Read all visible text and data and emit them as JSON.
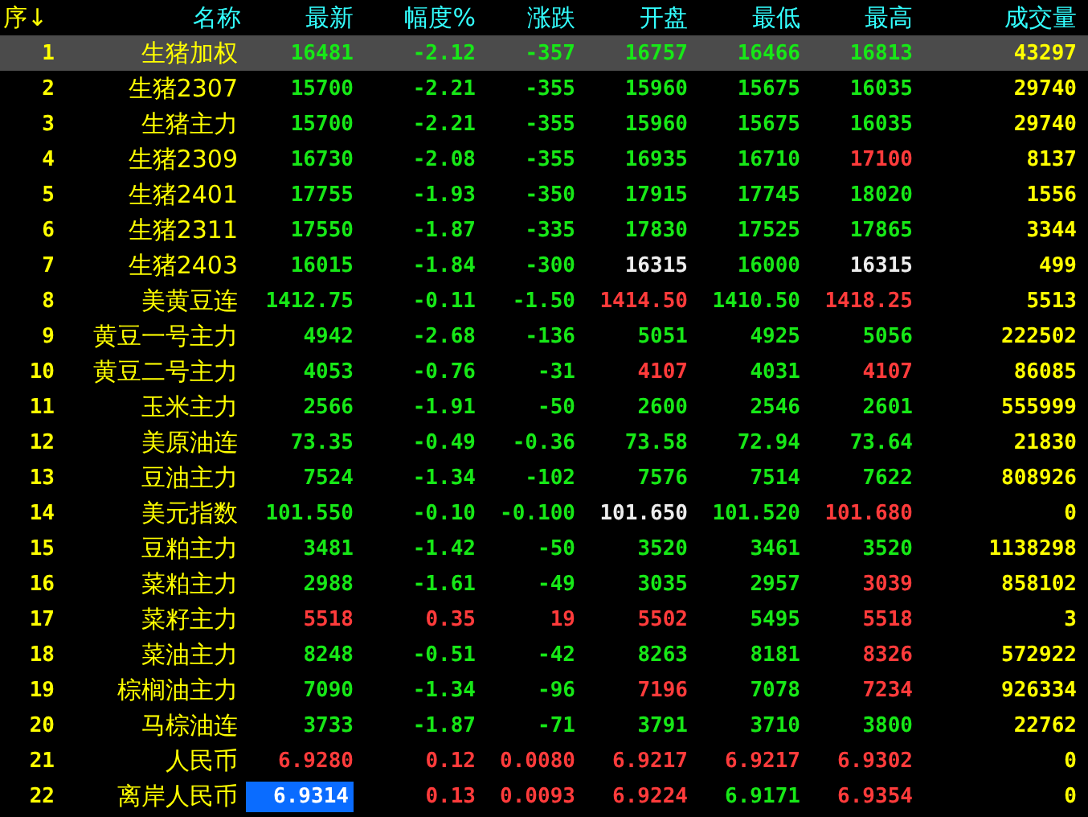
{
  "table": {
    "columns": [
      "序↓",
      "名称",
      "最新",
      "幅度%",
      "涨跌",
      "开盘",
      "最低",
      "最高",
      "成交量"
    ],
    "rows": [
      {
        "selected": true,
        "cells": [
          {
            "text": "1"
          },
          {
            "text": "生猪加权"
          },
          {
            "text": "16481",
            "color": "#17e817",
            "cursor": false
          },
          {
            "text": "-2.12",
            "color": "#17e817"
          },
          {
            "text": "-357",
            "color": "#17e817"
          },
          {
            "text": "16757",
            "color": "#17e817"
          },
          {
            "text": "16466",
            "color": "#17e817"
          },
          {
            "text": "16813",
            "color": "#17e817"
          },
          {
            "text": "43297"
          }
        ]
      },
      {
        "selected": false,
        "cells": [
          {
            "text": "2"
          },
          {
            "text": "生猪2307"
          },
          {
            "text": "15700",
            "color": "#17e817",
            "cursor": false
          },
          {
            "text": "-2.21",
            "color": "#17e817"
          },
          {
            "text": "-355",
            "color": "#17e817"
          },
          {
            "text": "15960",
            "color": "#17e817"
          },
          {
            "text": "15675",
            "color": "#17e817"
          },
          {
            "text": "16035",
            "color": "#17e817"
          },
          {
            "text": "29740"
          }
        ]
      },
      {
        "selected": false,
        "cells": [
          {
            "text": "3"
          },
          {
            "text": "生猪主力"
          },
          {
            "text": "15700",
            "color": "#17e817",
            "cursor": false
          },
          {
            "text": "-2.21",
            "color": "#17e817"
          },
          {
            "text": "-355",
            "color": "#17e817"
          },
          {
            "text": "15960",
            "color": "#17e817"
          },
          {
            "text": "15675",
            "color": "#17e817"
          },
          {
            "text": "16035",
            "color": "#17e817"
          },
          {
            "text": "29740"
          }
        ]
      },
      {
        "selected": false,
        "cells": [
          {
            "text": "4"
          },
          {
            "text": "生猪2309"
          },
          {
            "text": "16730",
            "color": "#17e817",
            "cursor": false
          },
          {
            "text": "-2.08",
            "color": "#17e817"
          },
          {
            "text": "-355",
            "color": "#17e817"
          },
          {
            "text": "16935",
            "color": "#17e817"
          },
          {
            "text": "16710",
            "color": "#17e817"
          },
          {
            "text": "17100",
            "color": "#ff3b3b"
          },
          {
            "text": "8137"
          }
        ]
      },
      {
        "selected": false,
        "cells": [
          {
            "text": "5"
          },
          {
            "text": "生猪2401"
          },
          {
            "text": "17755",
            "color": "#17e817",
            "cursor": false
          },
          {
            "text": "-1.93",
            "color": "#17e817"
          },
          {
            "text": "-350",
            "color": "#17e817"
          },
          {
            "text": "17915",
            "color": "#17e817"
          },
          {
            "text": "17745",
            "color": "#17e817"
          },
          {
            "text": "18020",
            "color": "#17e817"
          },
          {
            "text": "1556"
          }
        ]
      },
      {
        "selected": false,
        "cells": [
          {
            "text": "6"
          },
          {
            "text": "生猪2311"
          },
          {
            "text": "17550",
            "color": "#17e817",
            "cursor": false
          },
          {
            "text": "-1.87",
            "color": "#17e817"
          },
          {
            "text": "-335",
            "color": "#17e817"
          },
          {
            "text": "17830",
            "color": "#17e817"
          },
          {
            "text": "17525",
            "color": "#17e817"
          },
          {
            "text": "17865",
            "color": "#17e817"
          },
          {
            "text": "3344"
          }
        ]
      },
      {
        "selected": false,
        "cells": [
          {
            "text": "7"
          },
          {
            "text": "生猪2403"
          },
          {
            "text": "16015",
            "color": "#17e817",
            "cursor": false
          },
          {
            "text": "-1.84",
            "color": "#17e817"
          },
          {
            "text": "-300",
            "color": "#17e817"
          },
          {
            "text": "16315",
            "color": "#eeeeee"
          },
          {
            "text": "16000",
            "color": "#17e817"
          },
          {
            "text": "16315",
            "color": "#eeeeee"
          },
          {
            "text": "499"
          }
        ]
      },
      {
        "selected": false,
        "cells": [
          {
            "text": "8"
          },
          {
            "text": "美黄豆连"
          },
          {
            "text": "1412.75",
            "color": "#17e817",
            "cursor": false
          },
          {
            "text": "-0.11",
            "color": "#17e817"
          },
          {
            "text": "-1.50",
            "color": "#17e817"
          },
          {
            "text": "1414.50",
            "color": "#ff3b3b"
          },
          {
            "text": "1410.50",
            "color": "#17e817"
          },
          {
            "text": "1418.25",
            "color": "#ff3b3b"
          },
          {
            "text": "5513"
          }
        ]
      },
      {
        "selected": false,
        "cells": [
          {
            "text": "9"
          },
          {
            "text": "黄豆一号主力"
          },
          {
            "text": "4942",
            "color": "#17e817",
            "cursor": false
          },
          {
            "text": "-2.68",
            "color": "#17e817"
          },
          {
            "text": "-136",
            "color": "#17e817"
          },
          {
            "text": "5051",
            "color": "#17e817"
          },
          {
            "text": "4925",
            "color": "#17e817"
          },
          {
            "text": "5056",
            "color": "#17e817"
          },
          {
            "text": "222502"
          }
        ]
      },
      {
        "selected": false,
        "cells": [
          {
            "text": "10"
          },
          {
            "text": "黄豆二号主力"
          },
          {
            "text": "4053",
            "color": "#17e817",
            "cursor": false
          },
          {
            "text": "-0.76",
            "color": "#17e817"
          },
          {
            "text": "-31",
            "color": "#17e817"
          },
          {
            "text": "4107",
            "color": "#ff3b3b"
          },
          {
            "text": "4031",
            "color": "#17e817"
          },
          {
            "text": "4107",
            "color": "#ff3b3b"
          },
          {
            "text": "86085"
          }
        ]
      },
      {
        "selected": false,
        "cells": [
          {
            "text": "11"
          },
          {
            "text": "玉米主力"
          },
          {
            "text": "2566",
            "color": "#17e817",
            "cursor": false
          },
          {
            "text": "-1.91",
            "color": "#17e817"
          },
          {
            "text": "-50",
            "color": "#17e817"
          },
          {
            "text": "2600",
            "color": "#17e817"
          },
          {
            "text": "2546",
            "color": "#17e817"
          },
          {
            "text": "2601",
            "color": "#17e817"
          },
          {
            "text": "555999"
          }
        ]
      },
      {
        "selected": false,
        "cells": [
          {
            "text": "12"
          },
          {
            "text": "美原油连"
          },
          {
            "text": "73.35",
            "color": "#17e817",
            "cursor": false
          },
          {
            "text": "-0.49",
            "color": "#17e817"
          },
          {
            "text": "-0.36",
            "color": "#17e817"
          },
          {
            "text": "73.58",
            "color": "#17e817"
          },
          {
            "text": "72.94",
            "color": "#17e817"
          },
          {
            "text": "73.64",
            "color": "#17e817"
          },
          {
            "text": "21830"
          }
        ]
      },
      {
        "selected": false,
        "cells": [
          {
            "text": "13"
          },
          {
            "text": "豆油主力"
          },
          {
            "text": "7524",
            "color": "#17e817",
            "cursor": false
          },
          {
            "text": "-1.34",
            "color": "#17e817"
          },
          {
            "text": "-102",
            "color": "#17e817"
          },
          {
            "text": "7576",
            "color": "#17e817"
          },
          {
            "text": "7514",
            "color": "#17e817"
          },
          {
            "text": "7622",
            "color": "#17e817"
          },
          {
            "text": "808926"
          }
        ]
      },
      {
        "selected": false,
        "cells": [
          {
            "text": "14"
          },
          {
            "text": "美元指数"
          },
          {
            "text": "101.550",
            "color": "#17e817",
            "cursor": false
          },
          {
            "text": "-0.10",
            "color": "#17e817"
          },
          {
            "text": "-0.100",
            "color": "#17e817"
          },
          {
            "text": "101.650",
            "color": "#eeeeee"
          },
          {
            "text": "101.520",
            "color": "#17e817"
          },
          {
            "text": "101.680",
            "color": "#ff3b3b"
          },
          {
            "text": "0"
          }
        ]
      },
      {
        "selected": false,
        "cells": [
          {
            "text": "15"
          },
          {
            "text": "豆粕主力"
          },
          {
            "text": "3481",
            "color": "#17e817",
            "cursor": false
          },
          {
            "text": "-1.42",
            "color": "#17e817"
          },
          {
            "text": "-50",
            "color": "#17e817"
          },
          {
            "text": "3520",
            "color": "#17e817"
          },
          {
            "text": "3461",
            "color": "#17e817"
          },
          {
            "text": "3520",
            "color": "#17e817"
          },
          {
            "text": "1138298"
          }
        ]
      },
      {
        "selected": false,
        "cells": [
          {
            "text": "16"
          },
          {
            "text": "菜粕主力"
          },
          {
            "text": "2988",
            "color": "#17e817",
            "cursor": false
          },
          {
            "text": "-1.61",
            "color": "#17e817"
          },
          {
            "text": "-49",
            "color": "#17e817"
          },
          {
            "text": "3035",
            "color": "#17e817"
          },
          {
            "text": "2957",
            "color": "#17e817"
          },
          {
            "text": "3039",
            "color": "#ff3b3b"
          },
          {
            "text": "858102"
          }
        ]
      },
      {
        "selected": false,
        "cells": [
          {
            "text": "17"
          },
          {
            "text": "菜籽主力"
          },
          {
            "text": "5518",
            "color": "#ff3b3b",
            "cursor": false
          },
          {
            "text": "0.35",
            "color": "#ff3b3b"
          },
          {
            "text": "19",
            "color": "#ff3b3b"
          },
          {
            "text": "5502",
            "color": "#ff3b3b"
          },
          {
            "text": "5495",
            "color": "#17e817"
          },
          {
            "text": "5518",
            "color": "#ff3b3b"
          },
          {
            "text": "3"
          }
        ]
      },
      {
        "selected": false,
        "cells": [
          {
            "text": "18"
          },
          {
            "text": "菜油主力"
          },
          {
            "text": "8248",
            "color": "#17e817",
            "cursor": false
          },
          {
            "text": "-0.51",
            "color": "#17e817"
          },
          {
            "text": "-42",
            "color": "#17e817"
          },
          {
            "text": "8263",
            "color": "#17e817"
          },
          {
            "text": "8181",
            "color": "#17e817"
          },
          {
            "text": "8326",
            "color": "#ff3b3b"
          },
          {
            "text": "572922"
          }
        ]
      },
      {
        "selected": false,
        "cells": [
          {
            "text": "19"
          },
          {
            "text": "棕榈油主力"
          },
          {
            "text": "7090",
            "color": "#17e817",
            "cursor": false
          },
          {
            "text": "-1.34",
            "color": "#17e817"
          },
          {
            "text": "-96",
            "color": "#17e817"
          },
          {
            "text": "7196",
            "color": "#ff3b3b"
          },
          {
            "text": "7078",
            "color": "#17e817"
          },
          {
            "text": "7234",
            "color": "#ff3b3b"
          },
          {
            "text": "926334"
          }
        ]
      },
      {
        "selected": false,
        "cells": [
          {
            "text": "20"
          },
          {
            "text": "马棕油连"
          },
          {
            "text": "3733",
            "color": "#17e817",
            "cursor": false
          },
          {
            "text": "-1.87",
            "color": "#17e817"
          },
          {
            "text": "-71",
            "color": "#17e817"
          },
          {
            "text": "3791",
            "color": "#17e817"
          },
          {
            "text": "3710",
            "color": "#17e817"
          },
          {
            "text": "3800",
            "color": "#17e817"
          },
          {
            "text": "22762"
          }
        ]
      },
      {
        "selected": false,
        "cells": [
          {
            "text": "21"
          },
          {
            "text": "人民币"
          },
          {
            "text": "6.9280",
            "color": "#ff3b3b",
            "cursor": false
          },
          {
            "text": "0.12",
            "color": "#ff3b3b"
          },
          {
            "text": "0.0080",
            "color": "#ff3b3b"
          },
          {
            "text": "6.9217",
            "color": "#ff3b3b"
          },
          {
            "text": "6.9217",
            "color": "#ff3b3b"
          },
          {
            "text": "6.9302",
            "color": "#ff3b3b"
          },
          {
            "text": "0"
          }
        ]
      },
      {
        "selected": false,
        "cells": [
          {
            "text": "22"
          },
          {
            "text": "离岸人民币"
          },
          {
            "text": "6.9314",
            "cursor": true
          },
          {
            "text": "0.13",
            "color": "#ff3b3b"
          },
          {
            "text": "0.0093",
            "color": "#ff3b3b"
          },
          {
            "text": "6.9224",
            "color": "#ff3b3b"
          },
          {
            "text": "6.9171",
            "color": "#17e817"
          },
          {
            "text": "6.9354",
            "color": "#ff3b3b"
          },
          {
            "text": "0"
          }
        ]
      }
    ]
  }
}
